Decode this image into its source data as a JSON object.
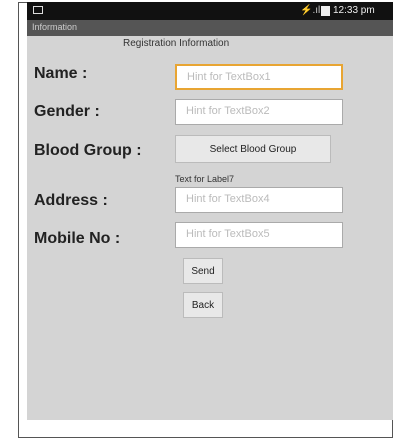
{
  "status_bar": {
    "time": "12:33 pm",
    "signal_glyph": "⚡.ıl"
  },
  "window": {
    "title": "Information"
  },
  "form": {
    "header": "Registration Information",
    "name_label": "Name :",
    "name_placeholder": "Hint for TextBox1",
    "gender_label": "Gender :",
    "gender_placeholder": "Hint for TextBox2",
    "blood_label": "Blood Group :",
    "blood_button": "Select Blood Group",
    "blood_value_label": "Text for Label7",
    "address_label": "Address :",
    "address_placeholder": "Hint for TextBox4",
    "mobile_label": "Mobile No :",
    "mobile_placeholder": "Hint for TextBox5",
    "send_button": "Send",
    "back_button": "Back"
  }
}
